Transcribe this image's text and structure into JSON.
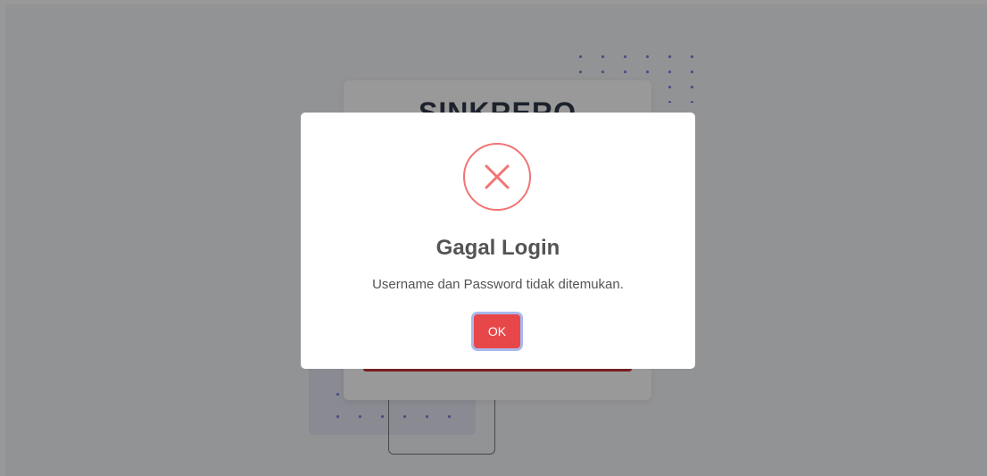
{
  "background": {
    "brand": "SINKRERO"
  },
  "dialog": {
    "icon": "error-x-icon",
    "icon_color": "#f27474",
    "title": "Gagal Login",
    "message": "Username dan Password tidak ditemukan.",
    "ok_label": "OK",
    "ok_color": "#e8474a"
  }
}
